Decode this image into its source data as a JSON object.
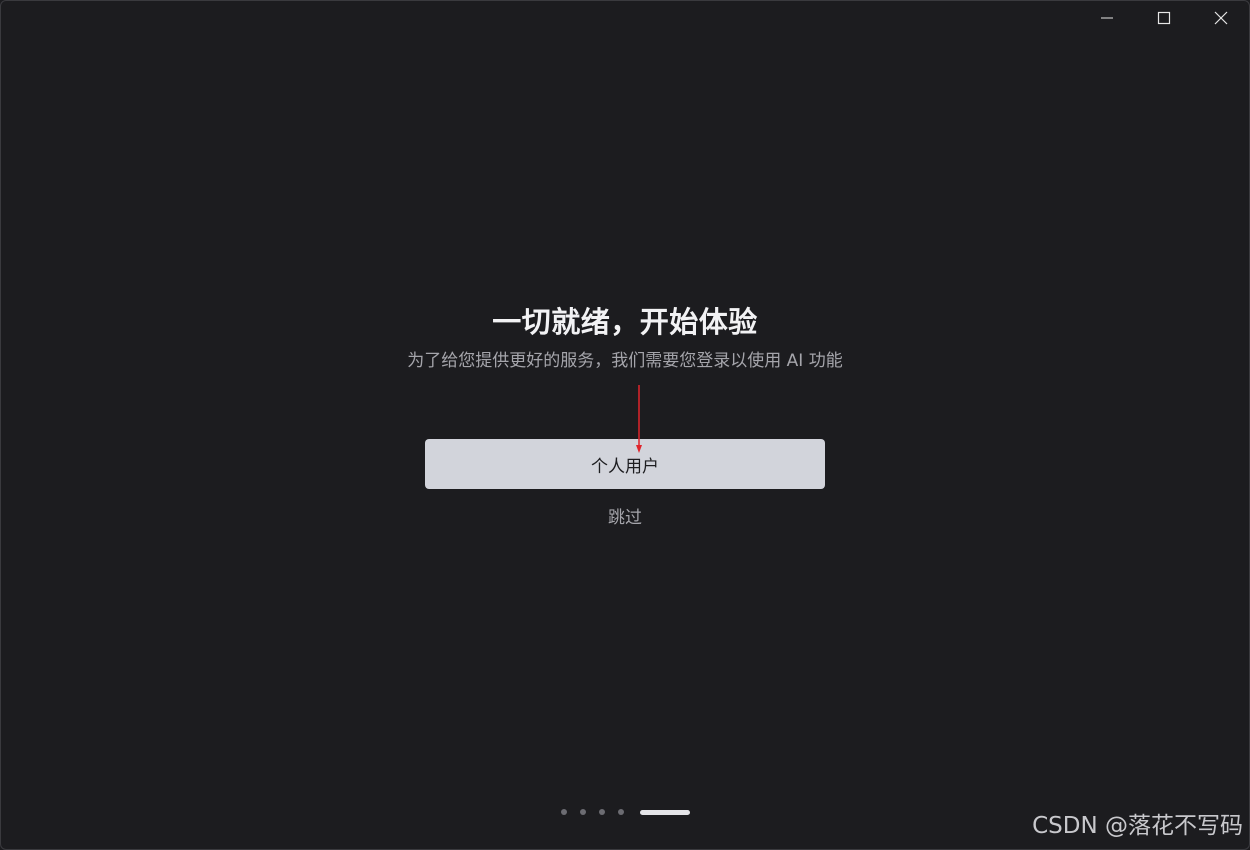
{
  "window": {
    "controls": {
      "minimize_icon": "minimize-icon",
      "maximize_icon": "maximize-icon",
      "close_icon": "close-icon"
    }
  },
  "main": {
    "title": "一切就绪，开始体验",
    "subtitle": "为了给您提供更好的服务，我们需要您登录以使用 AI 功能",
    "primary_button_label": "个人用户",
    "skip_label": "跳过"
  },
  "pager": {
    "total_steps": 5,
    "current_step": 5
  },
  "watermark": {
    "text": "CSDN @落花不写码"
  },
  "colors": {
    "background": "#1c1c1f",
    "button_bg": "#d2d4db",
    "annotation_arrow": "#e0242b",
    "pager_active": "#e4e4e8",
    "pager_inactive": "#6c6c72"
  }
}
